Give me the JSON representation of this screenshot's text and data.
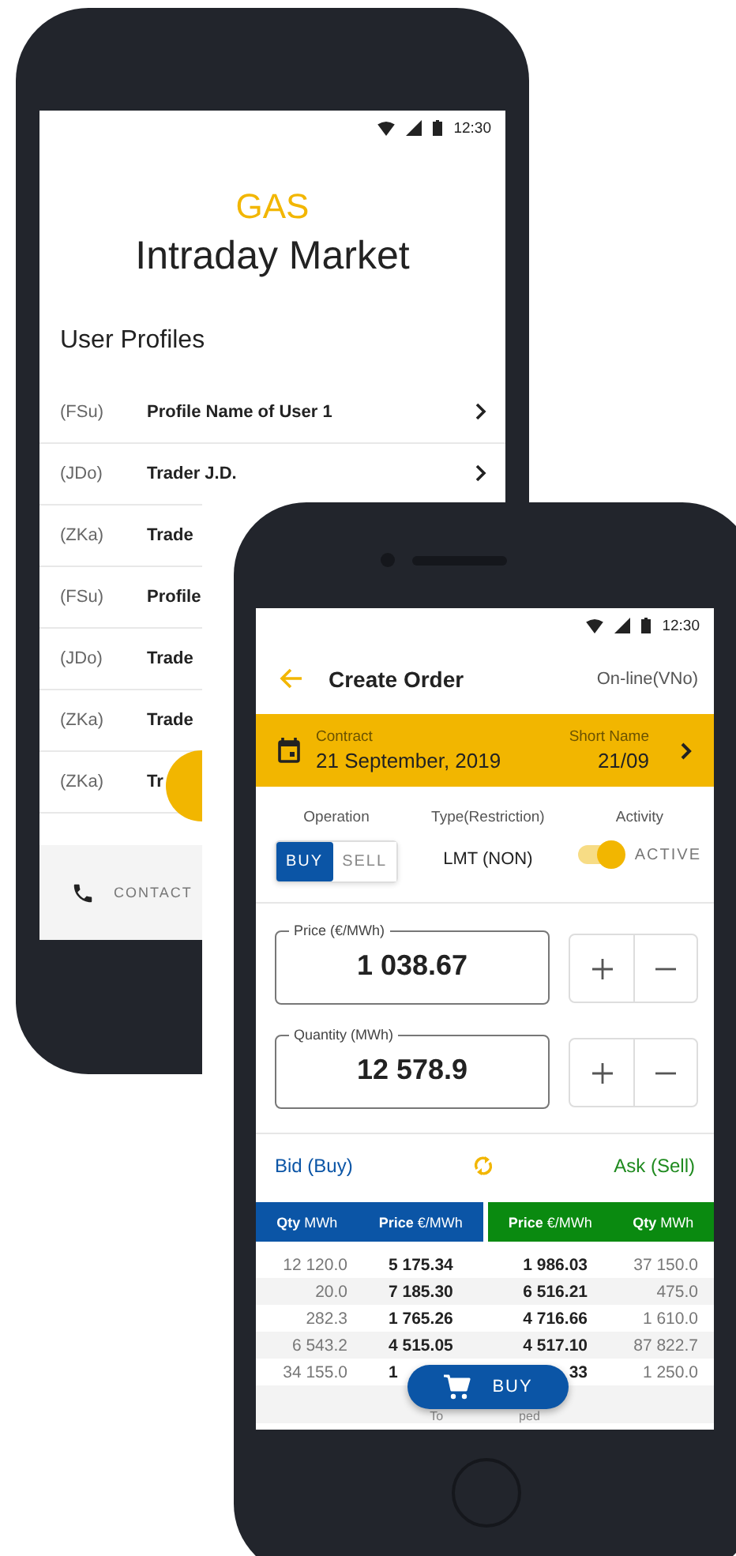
{
  "profiles_screen": {
    "status_time": "12:30",
    "brand": "GAS",
    "title": "Intraday Market",
    "section_title": "User Profiles",
    "profiles": [
      {
        "code": "(FSu)",
        "name": "Profile Name of User 1"
      },
      {
        "code": "(JDo)",
        "name": "Trader J.D."
      },
      {
        "code": "(ZKa)",
        "name": "Trade"
      },
      {
        "code": "(FSu)",
        "name": "Profile"
      },
      {
        "code": "(JDo)",
        "name": "Trade"
      },
      {
        "code": "(ZKa)",
        "name": "Trade"
      },
      {
        "code": "(ZKa)",
        "name": "Tr"
      }
    ],
    "contact_label": "CONTACT"
  },
  "order_screen": {
    "status_time": "12:30",
    "title": "Create Order",
    "status": "On-line(VNo)",
    "contract": {
      "label": "Contract",
      "value": "21 September, 2019"
    },
    "short_name": {
      "label": "Short Name",
      "value": "21/09"
    },
    "operation": {
      "label": "Operation",
      "options": [
        {
          "label": "BUY",
          "selected": true
        },
        {
          "label": "SELL",
          "selected": false
        }
      ]
    },
    "type": {
      "label": "Type(Restriction)",
      "value": "LMT (NON)"
    },
    "activity": {
      "label": "Activity",
      "on": true,
      "text": "ACTIVE"
    },
    "price": {
      "label": "Price (€/MWh)",
      "value": "1 038.67"
    },
    "quantity": {
      "label": "Quantity (MWh)",
      "value": "12 578.9"
    },
    "bid_label": "Bid (Buy)",
    "ask_label": "Ask (Sell)",
    "bid_columns": [
      "**Qty** MWh",
      "**Price** €/MWh"
    ],
    "ask_columns": [
      "**Price** €/MWh",
      "**Qty** MWh"
    ],
    "rows": [
      {
        "bid_qty": "12 120.0",
        "bid_price": "5 175.34",
        "ask_price": "1 986.03",
        "ask_qty": "37 150.0"
      },
      {
        "bid_qty": "20.0",
        "bid_price": "7 185.30",
        "ask_price": "6 516.21",
        "ask_qty": "475.0"
      },
      {
        "bid_qty": "282.3",
        "bid_price": "1 765.26",
        "ask_price": "4 716.66",
        "ask_qty": "1 610.0"
      },
      {
        "bid_qty": "6 543.2",
        "bid_price": "4 515.05",
        "ask_price": "4 517.10",
        "ask_qty": "87 822.7"
      },
      {
        "bid_qty": "34 155.0",
        "bid_price": "1",
        "ask_price": "33",
        "ask_qty": "1 250.0"
      }
    ],
    "footer_left": "To",
    "footer_right": "ped",
    "buy_button": "BUY"
  }
}
